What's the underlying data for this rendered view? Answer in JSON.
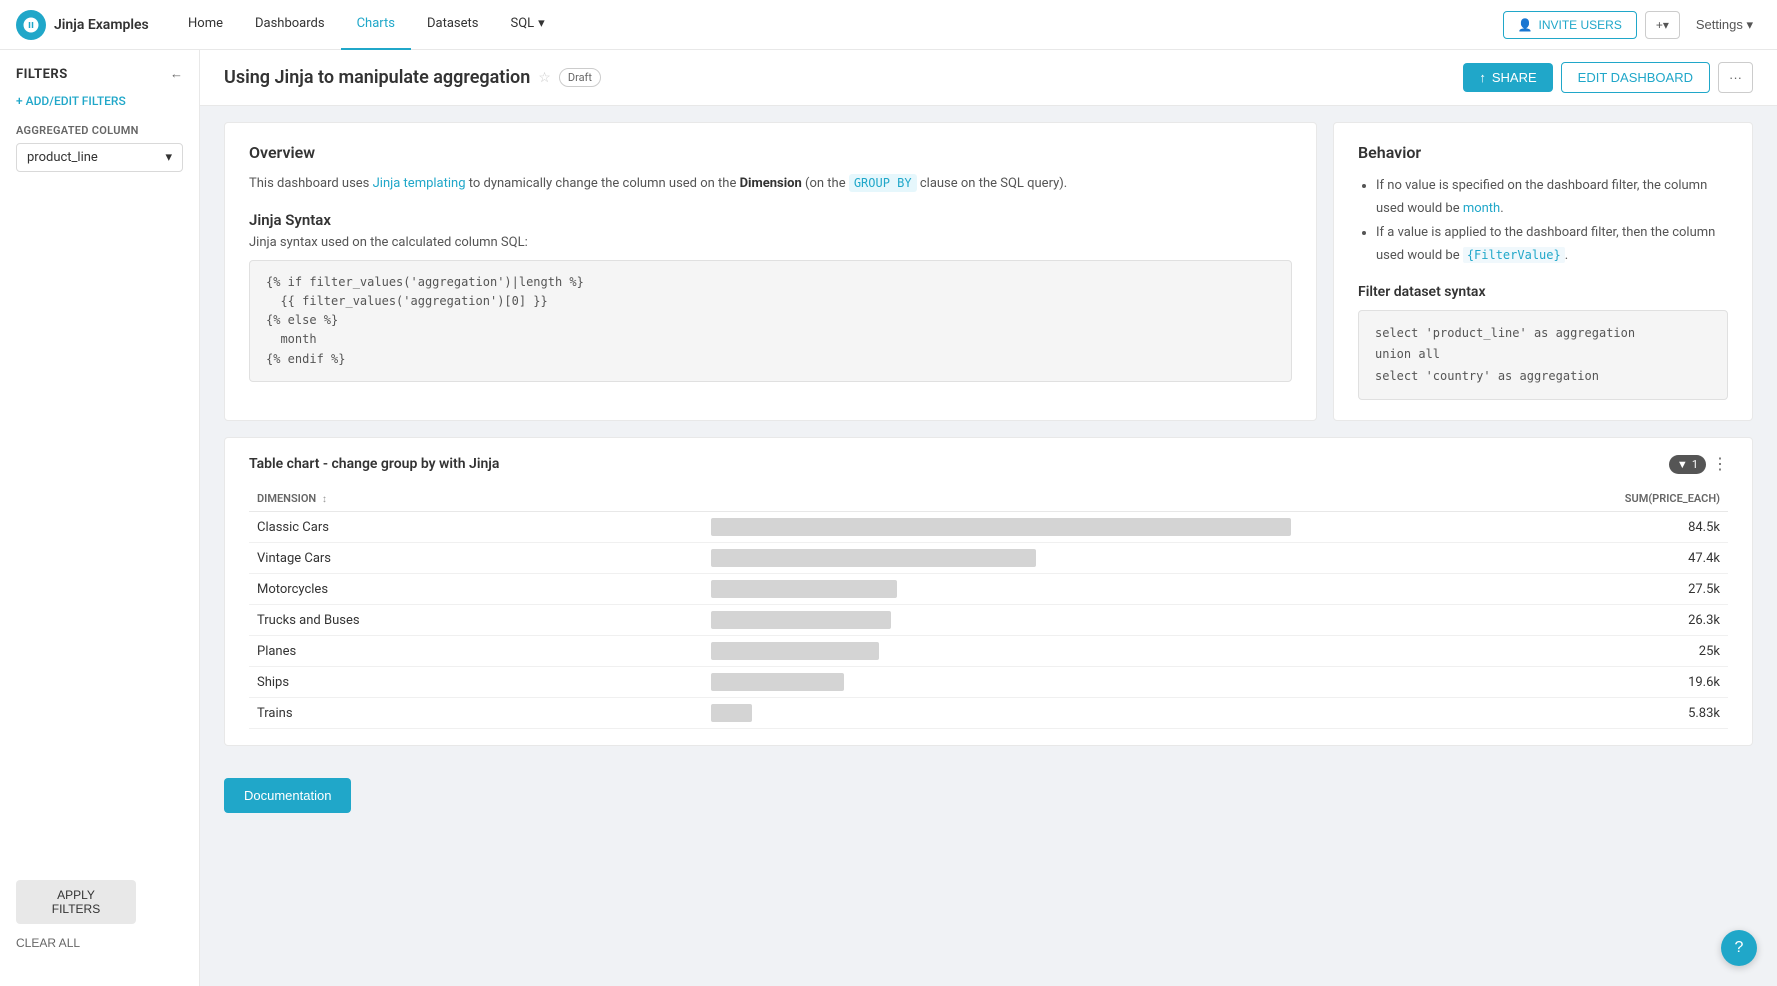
{
  "app": {
    "logo_text": "Jinja Examples"
  },
  "nav": {
    "items": [
      {
        "id": "home",
        "label": "Home",
        "active": false
      },
      {
        "id": "dashboards",
        "label": "Dashboards",
        "active": false
      },
      {
        "id": "charts",
        "label": "Charts",
        "active": true
      },
      {
        "id": "datasets",
        "label": "Datasets",
        "active": false
      },
      {
        "id": "sql",
        "label": "SQL",
        "active": false,
        "has_dropdown": true
      }
    ],
    "invite_users_label": "INVITE USERS",
    "plus_label": "+▾",
    "settings_label": "Settings ▾"
  },
  "sidebar": {
    "title": "Filters",
    "add_edit_label": "+ ADD/EDIT FILTERS",
    "aggregated_column_label": "Aggregated column",
    "aggregated_column_value": "product_line",
    "apply_label": "APPLY FILTERS",
    "clear_label": "CLEAR ALL"
  },
  "dashboard": {
    "title": "Using Jinja to manipulate aggregation",
    "draft_label": "Draft",
    "share_label": "SHARE",
    "edit_label": "EDIT DASHBOARD",
    "more_label": "···"
  },
  "overview_card": {
    "title": "Overview",
    "intro_text_pre": "This dashboard uses ",
    "intro_link": "Jinja templating",
    "intro_text_mid": " to dynamically change the column used on the ",
    "intro_bold": "Dimension",
    "intro_text_post": " (on the ",
    "intro_code": "GROUP BY",
    "intro_text_end": " clause on the SQL query).",
    "jinja_title": "Jinja Syntax",
    "jinja_subtitle": "Jinja syntax used on the calculated column SQL:",
    "code": "{% if filter_values('aggregation')|length %}\n  {{ filter_values('aggregation')[0] }}\n{% else %}\n  month\n{% endif %}"
  },
  "behavior_card": {
    "title": "Behavior",
    "bullet1_pre": "If no value is specified on the dashboard filter, the column used would be ",
    "bullet1_link": "month",
    "bullet1_post": ".",
    "bullet2_pre": "If a value is applied to the dashboard filter, then the column used would be ",
    "bullet2_code": "{FilterValue}",
    "bullet2_post": ".",
    "filter_dataset_title": "Filter dataset syntax",
    "code": "select 'product_line' as aggregation\nunion all\nselect 'country' as aggregation"
  },
  "table_chart": {
    "title": "Table chart - change group by with Jinja",
    "filter_badge": "1",
    "column_dimension": "dimension",
    "column_sum": "SUM(price_each)",
    "rows": [
      {
        "label": "Classic Cars",
        "value": "84.5k",
        "bar_pct": 100
      },
      {
        "label": "Vintage Cars",
        "value": "47.4k",
        "bar_pct": 56
      },
      {
        "label": "Motorcycles",
        "value": "27.5k",
        "bar_pct": 32
      },
      {
        "label": "Trucks and Buses",
        "value": "26.3k",
        "bar_pct": 31
      },
      {
        "label": "Planes",
        "value": "25k",
        "bar_pct": 29
      },
      {
        "label": "Ships",
        "value": "19.6k",
        "bar_pct": 23
      },
      {
        "label": "Trains",
        "value": "5.83k",
        "bar_pct": 7
      }
    ]
  },
  "docs": {
    "button_label": "Documentation"
  }
}
